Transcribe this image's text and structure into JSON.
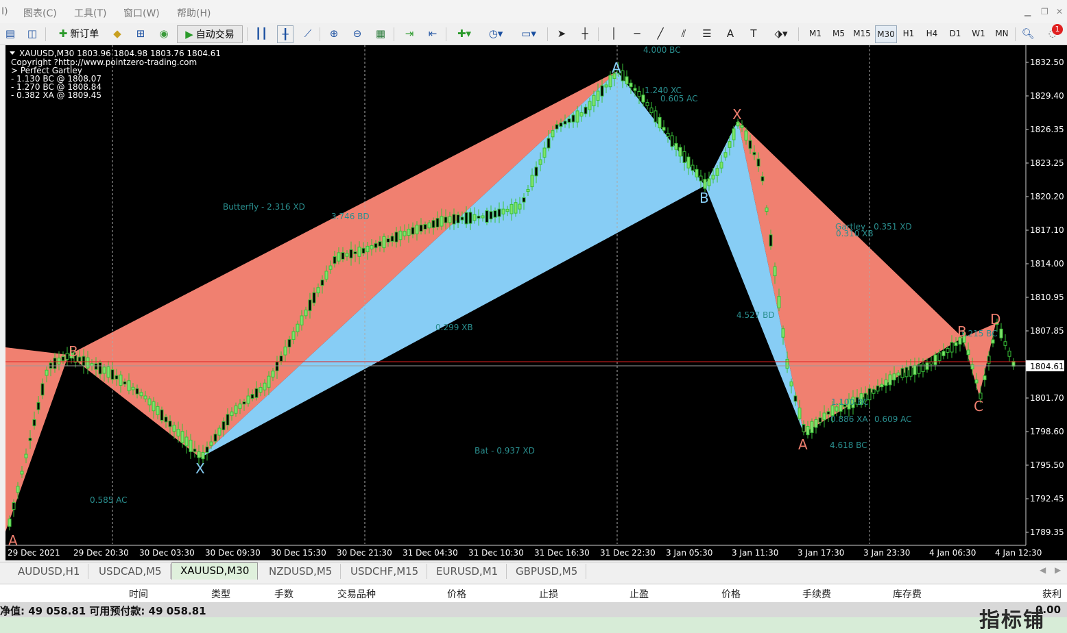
{
  "menu": {
    "items": [
      "I)",
      "图表(C)",
      "工具(T)",
      "窗口(W)",
      "帮助(H)"
    ]
  },
  "toolbar": {
    "new_order_label": "新订单",
    "auto_trade_label": "自动交易",
    "timeframes": [
      "M1",
      "M5",
      "M15",
      "M30",
      "H1",
      "H4",
      "D1",
      "W1",
      "MN"
    ],
    "active_timeframe": "M30",
    "notification_count": "1"
  },
  "chart": {
    "header": {
      "symbol_line": "XAUUSD,M30  1803.96 1804.98 1803.76 1804.61",
      "copyright": "Copyright ?http://www.pointzero-trading.com",
      "pattern": "> Perfect Gartley",
      "levels": [
        "- 1.130 BC @ 1808.07",
        "- 1.270 BC @ 1808.84",
        "- 0.382 XA @ 1809.45"
      ]
    },
    "current_price": "1804.61",
    "colors": {
      "bearish_pattern": "#f08070",
      "bullish_pattern": "#87cdf5",
      "bull_candle": "#7fe36a",
      "bear_candle": "#000000",
      "wick": "#39c239",
      "label_teal": "#2a8f8f",
      "price_line": "#e02020"
    },
    "annotations": [
      {
        "text": "Butterfly - 2.316 XD",
        "color": "teal"
      },
      {
        "text": "3.746 BD",
        "color": "teal"
      },
      {
        "text": "0.299 XB",
        "color": "teal"
      },
      {
        "text": "Bat - 0.937 XD",
        "color": "teal"
      },
      {
        "text": "0.585 AC",
        "color": "teal"
      },
      {
        "text": "4.000 BC",
        "color": "teal"
      },
      {
        "text": "1.240 XC",
        "color": "teal"
      },
      {
        "text": "0.605 AC",
        "color": "teal"
      },
      {
        "text": "Gartley - 0.351 XD",
        "color": "teal"
      },
      {
        "text": "0.310 XB",
        "color": "teal"
      },
      {
        "text": "4.527 BD",
        "color": "teal"
      },
      {
        "text": "1.100 BC",
        "color": "teal"
      },
      {
        "text": "0.886 XA",
        "color": "teal"
      },
      {
        "text": "0.609 AC",
        "color": "teal"
      },
      {
        "text": "4.618 BC",
        "color": "teal"
      },
      {
        "text": "1.215 BC",
        "color": "teal"
      }
    ],
    "pivots": [
      {
        "text": "A",
        "color": "salmon"
      },
      {
        "text": "B",
        "color": "salmon"
      },
      {
        "text": "X",
        "color": "blue"
      },
      {
        "text": "A",
        "color": "blue"
      },
      {
        "text": "B",
        "color": "blue"
      },
      {
        "text": "X",
        "color": "salmon"
      },
      {
        "text": "A",
        "color": "salmon"
      },
      {
        "text": "B",
        "color": "salmon"
      },
      {
        "text": "C",
        "color": "salmon"
      },
      {
        "text": "D",
        "color": "salmon"
      }
    ],
    "y_ticks": [
      "1832.50",
      "1829.40",
      "1826.35",
      "1823.25",
      "1820.20",
      "1817.10",
      "1814.00",
      "1810.95",
      "1807.85",
      "1801.70",
      "1798.60",
      "1795.50",
      "1792.45",
      "1789.35"
    ],
    "x_ticks": [
      "29 Dec 2021",
      "29 Dec 20:30",
      "30 Dec 03:30",
      "30 Dec 09:30",
      "30 Dec 15:30",
      "30 Dec 21:30",
      "31 Dec 04:30",
      "31 Dec 10:30",
      "31 Dec 16:30",
      "31 Dec 22:30",
      "3 Jan 05:30",
      "3 Jan 11:30",
      "3 Jan 17:30",
      "3 Jan 23:30",
      "4 Jan 06:30",
      "4 Jan 12:30"
    ]
  },
  "tabs": [
    "AUDUSD,H1",
    "USDCAD,M5",
    "XAUUSD,M30",
    "NZDUSD,M5",
    "USDCHF,M15",
    "EURUSD,M1",
    "GBPUSD,M5"
  ],
  "active_tab": "XAUUSD,M30",
  "terminal": {
    "columns": [
      "时间",
      "类型",
      "手数",
      "交易品种",
      "价格",
      "止损",
      "止盈",
      "价格",
      "手续费",
      "库存费",
      "获利"
    ],
    "balance_text": "净值: 49 058.81  可用预付款: 49 058.81",
    "profit_value": "0.00"
  },
  "watermark": "指标铺"
}
